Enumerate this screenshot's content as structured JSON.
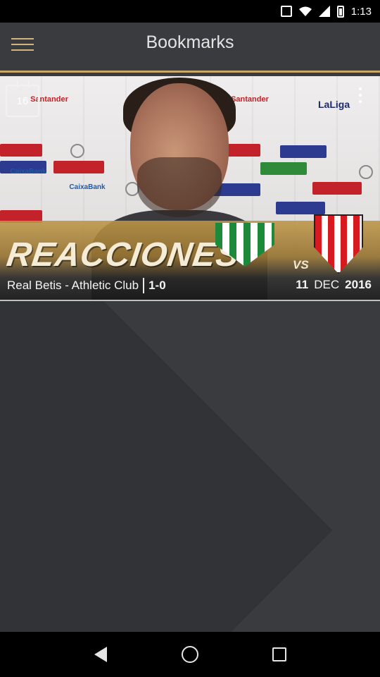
{
  "status_bar": {
    "time": "1:13",
    "icons": [
      "notification-square-icon",
      "wifi-icon",
      "signal-icon",
      "battery-icon"
    ]
  },
  "header": {
    "title": "Bookmarks",
    "menu_icon": "hamburger-menu-icon"
  },
  "bookmark": {
    "thumbnail_headline": "REACCIONES",
    "thumbnail_vs": "VS",
    "thumbnail_brand": "LaLiga",
    "counter": "16",
    "match": "Real Betis - Athletic Club",
    "score": "1-0",
    "date_day": "11",
    "date_month": "DEC",
    "date_year": "2016"
  },
  "colors": {
    "accent": "#c7a86a",
    "background": "#3a3b3e",
    "header_text": "#e4e4e4"
  },
  "nav_bar": {
    "buttons": [
      "back-icon",
      "home-icon",
      "recent-apps-icon"
    ]
  }
}
